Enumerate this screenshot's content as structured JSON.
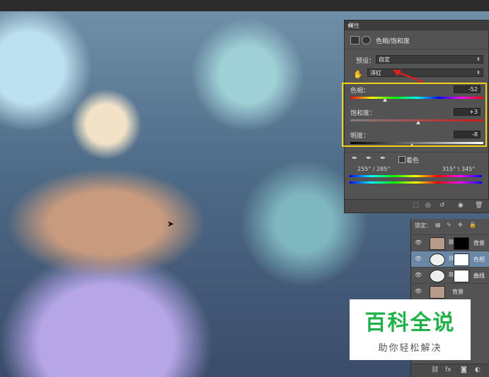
{
  "properties_panel": {
    "tab_label": "属性",
    "collapse_glyph": "▸▸",
    "adjustment_title": "色相/饱和度",
    "preset_label": "预设：",
    "preset_value": "自定",
    "channel_value": "洋红",
    "hue_label": "色相：",
    "hue_value": "-52",
    "saturation_label": "饱和度：",
    "saturation_value": "+3",
    "lightness_label": "明度：",
    "lightness_value": "-8",
    "colorize_label": "着色",
    "range_left": "255° / 285°",
    "range_right": "315° \\ 345°"
  },
  "layers_panel": {
    "lock_label": "锁定：",
    "layers": [
      {
        "name": "背景",
        "selected": false
      },
      {
        "name": "色相",
        "selected": true
      },
      {
        "name": "曲线",
        "selected": false
      },
      {
        "name": "背景",
        "selected": false
      }
    ]
  },
  "watermark": {
    "title": "百科全说",
    "subtitle": "助你轻松解决"
  },
  "colors": {
    "highlight_box": "#f0d21a",
    "annotation_arrow": "#e02020",
    "selected_layer": "#6b87a8",
    "watermark_green": "#20b14a"
  },
  "icons": [
    "adjustment-icon",
    "mask-icon",
    "hand-icon",
    "eyedropper-icon",
    "eyedropper-plus-icon",
    "eyedropper-minus-icon",
    "eye-icon",
    "link-icon",
    "lock-icon",
    "trash-icon"
  ]
}
